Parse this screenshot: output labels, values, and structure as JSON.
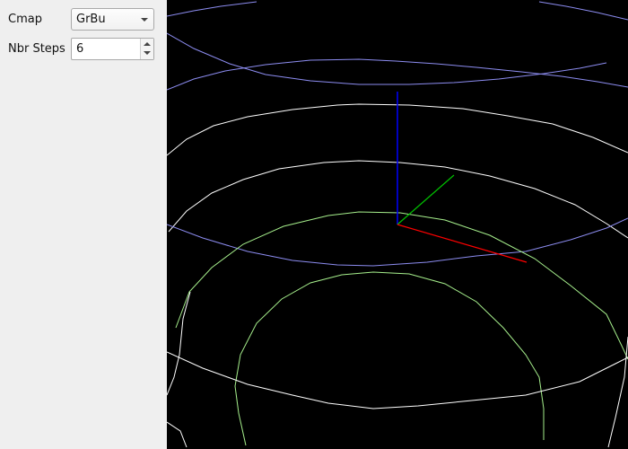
{
  "controls": {
    "cmap": {
      "label": "Cmap",
      "value": "GrBu"
    },
    "steps": {
      "label": "Nbr Steps",
      "value": "6"
    }
  },
  "viewport": {
    "background": "#000000",
    "colors": {
      "blue_contour": "#8c8cf0",
      "white_contour": "#ffffff",
      "green_contour": "#a6ef8c",
      "axis_x": "#ff0000",
      "axis_y": "#00c000",
      "axis_z": "#0000ff"
    }
  }
}
